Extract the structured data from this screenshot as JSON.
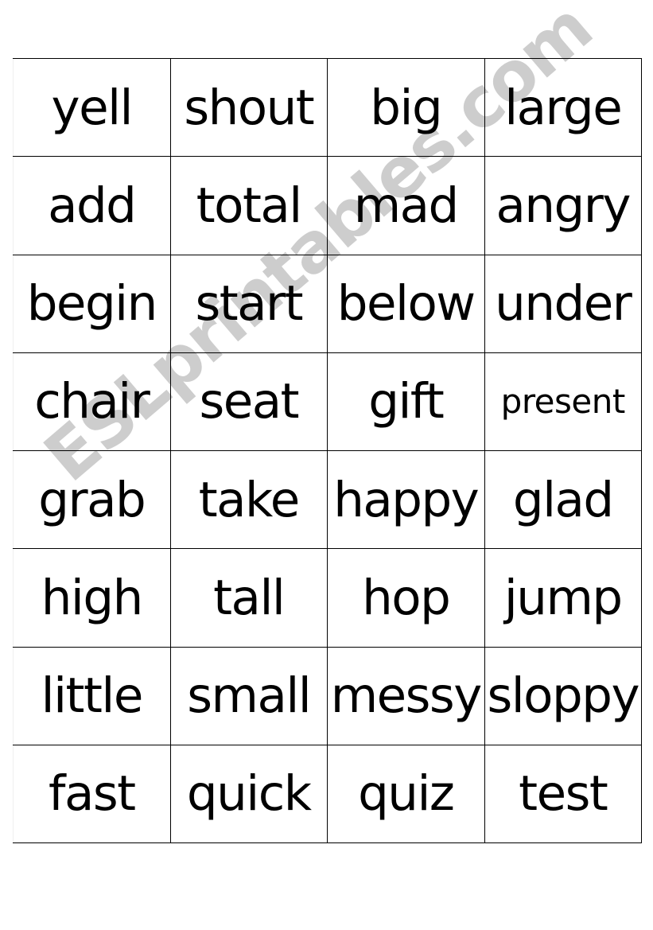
{
  "document": {
    "type": "word-matching-flashcard-grid",
    "background_color": "#ffffff",
    "border_color": "#000000",
    "text_color": "#000000"
  },
  "watermark": {
    "text": "ESLprintables.com",
    "color": "#cdcdcd",
    "rotation_degrees": -40.5
  },
  "grid": {
    "columns": 4,
    "rows": 8,
    "cells": [
      [
        {
          "word": "yell",
          "size": "normal"
        },
        {
          "word": "shout",
          "size": "normal"
        },
        {
          "word": "big",
          "size": "normal"
        },
        {
          "word": "large",
          "size": "normal"
        }
      ],
      [
        {
          "word": "add",
          "size": "normal"
        },
        {
          "word": "total",
          "size": "normal"
        },
        {
          "word": "mad",
          "size": "normal"
        },
        {
          "word": "angry",
          "size": "normal"
        }
      ],
      [
        {
          "word": "begin",
          "size": "normal"
        },
        {
          "word": "start",
          "size": "normal"
        },
        {
          "word": "below",
          "size": "normal"
        },
        {
          "word": "under",
          "size": "normal"
        }
      ],
      [
        {
          "word": "chair",
          "size": "normal"
        },
        {
          "word": "seat",
          "size": "normal"
        },
        {
          "word": "gift",
          "size": "normal"
        },
        {
          "word": "present",
          "size": "small"
        }
      ],
      [
        {
          "word": "grab",
          "size": "normal"
        },
        {
          "word": "take",
          "size": "normal"
        },
        {
          "word": "happy",
          "size": "normal"
        },
        {
          "word": "glad",
          "size": "normal"
        }
      ],
      [
        {
          "word": "high",
          "size": "normal"
        },
        {
          "word": "tall",
          "size": "normal"
        },
        {
          "word": "hop",
          "size": "normal"
        },
        {
          "word": "jump",
          "size": "normal"
        }
      ],
      [
        {
          "word": "little",
          "size": "normal"
        },
        {
          "word": "small",
          "size": "normal"
        },
        {
          "word": "messy",
          "size": "normal"
        },
        {
          "word": "sloppy",
          "size": "normal"
        }
      ],
      [
        {
          "word": "fast",
          "size": "normal"
        },
        {
          "word": "quick",
          "size": "normal"
        },
        {
          "word": "quiz",
          "size": "normal"
        },
        {
          "word": "test",
          "size": "normal"
        }
      ]
    ]
  }
}
